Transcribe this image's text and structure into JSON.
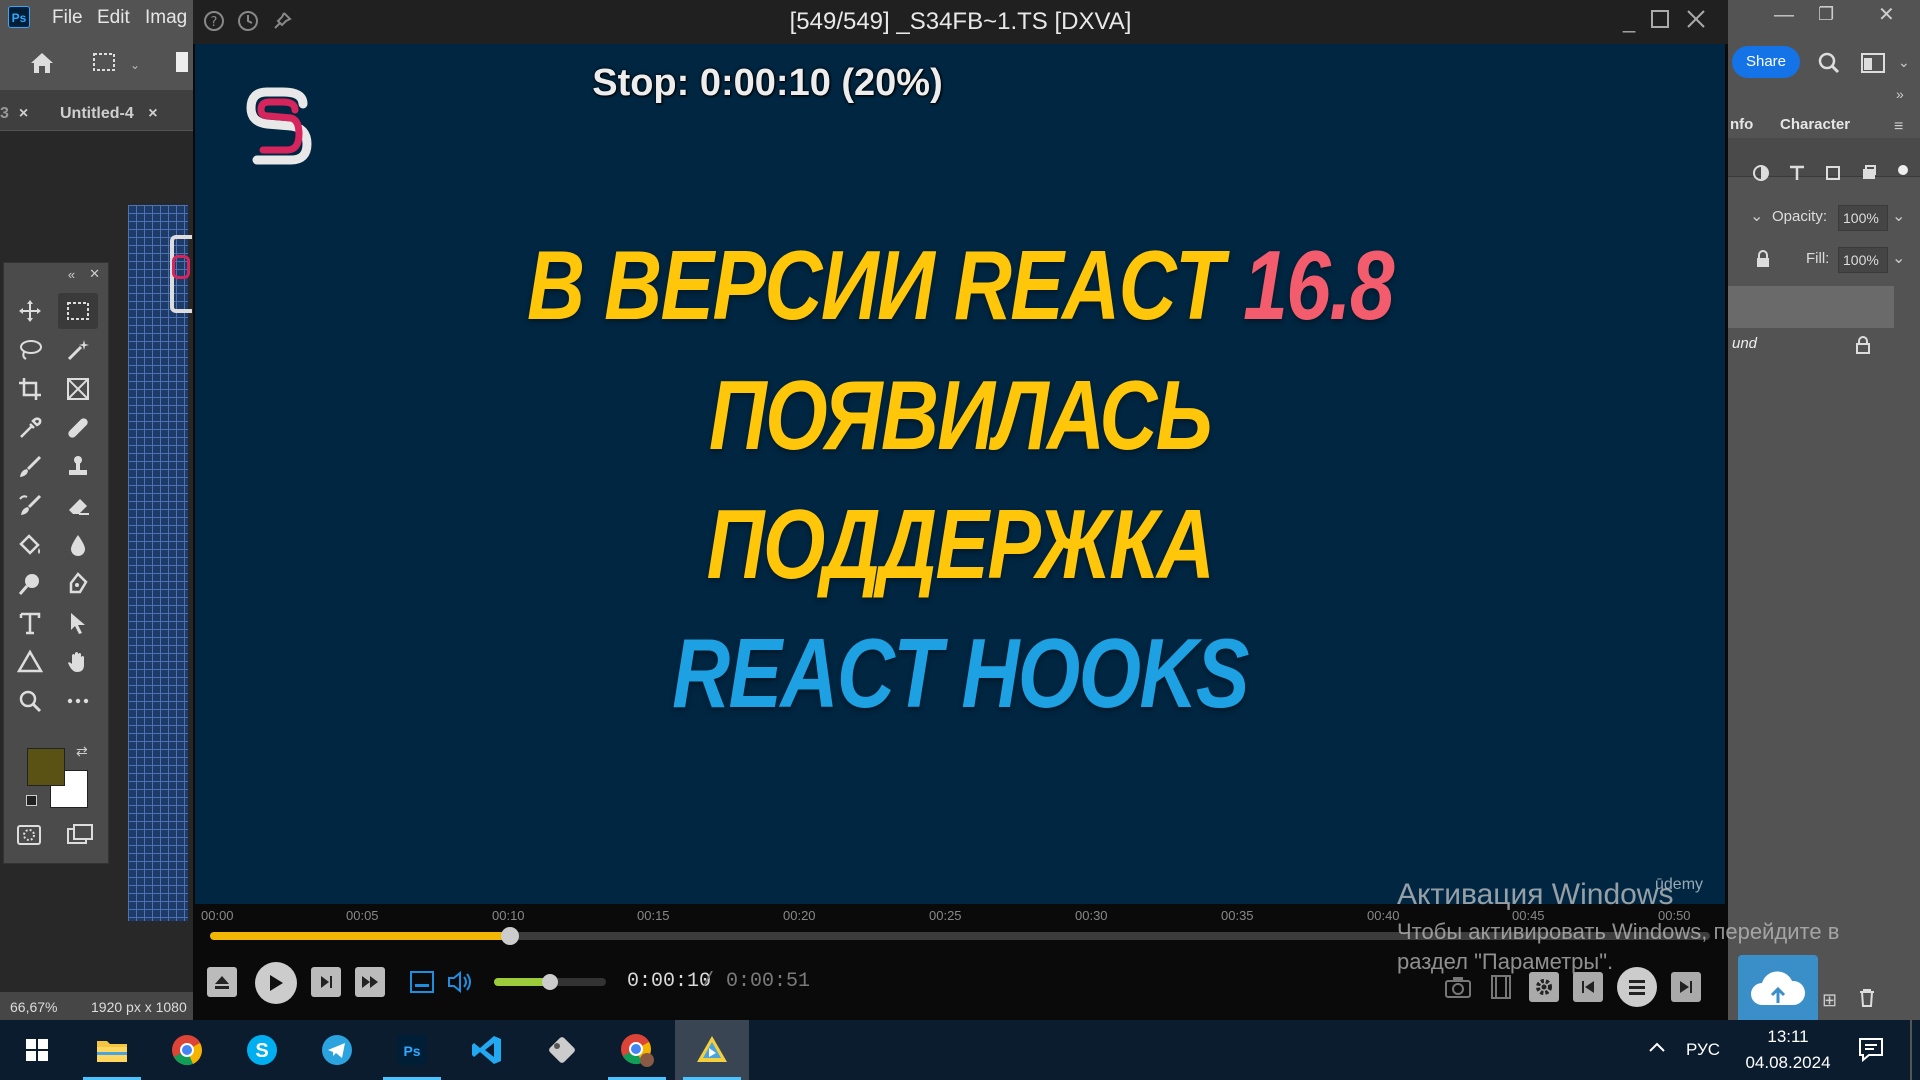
{
  "photoshop": {
    "logo": "Ps",
    "menu": [
      "File",
      "Edit",
      "Imag"
    ],
    "tabs": [
      {
        "label": "",
        "close": "×"
      },
      {
        "label": "Untitled-4",
        "close": "×"
      }
    ],
    "status": {
      "zoom": "66,67%",
      "size": "1920 px x 1080"
    },
    "right": {
      "share_label": "Share",
      "panel_tabs": [
        "nfo",
        "Character"
      ],
      "opacity_label": "Opacity:",
      "opacity_value": "100%",
      "fill_label": "Fill:",
      "fill_value": "100%",
      "layer_name": "und"
    },
    "colors": {
      "foreground": "#5a5114",
      "background": "#ffffff"
    }
  },
  "player": {
    "title": "[549/549] _S34FB~1.TS [DXVA]",
    "osd": "Stop: 0:00:10 (20%)",
    "slide": {
      "line1_a": "В ВЕРСИИ REACT ",
      "line1_b": "16.8",
      "line2": "ПОЯВИЛАСЬ",
      "line3": "ПОДДЕРЖКА",
      "line4": "REACT HOOKS",
      "watermark": "ūdemy",
      "colors": {
        "yellow": "#ffc60a",
        "pink": "#f25c6c",
        "blue": "#1da1e2",
        "bg": "#002641"
      }
    },
    "timeline": [
      "00:00",
      "00:05",
      "00:10",
      "00:15",
      "00:20",
      "00:25",
      "00:30",
      "00:35",
      "00:40",
      "00:45",
      "00:50"
    ],
    "progress_fraction": 0.2,
    "volume_fraction": 0.5,
    "time_current": "0:00:10",
    "time_total": "/ 0:00:51"
  },
  "activation": {
    "title": "Активация Windows",
    "text": "Чтобы активировать Windows, перейдите в раздел \"Параметры\"."
  },
  "taskbar": {
    "apps": [
      "start",
      "file-explorer",
      "chrome",
      "skype",
      "telegram",
      "photoshop",
      "vscode",
      "app-tool",
      "chrome-profile",
      "media-player"
    ],
    "lang": "РУС",
    "time": "13:11",
    "date": "04.08.2024"
  }
}
